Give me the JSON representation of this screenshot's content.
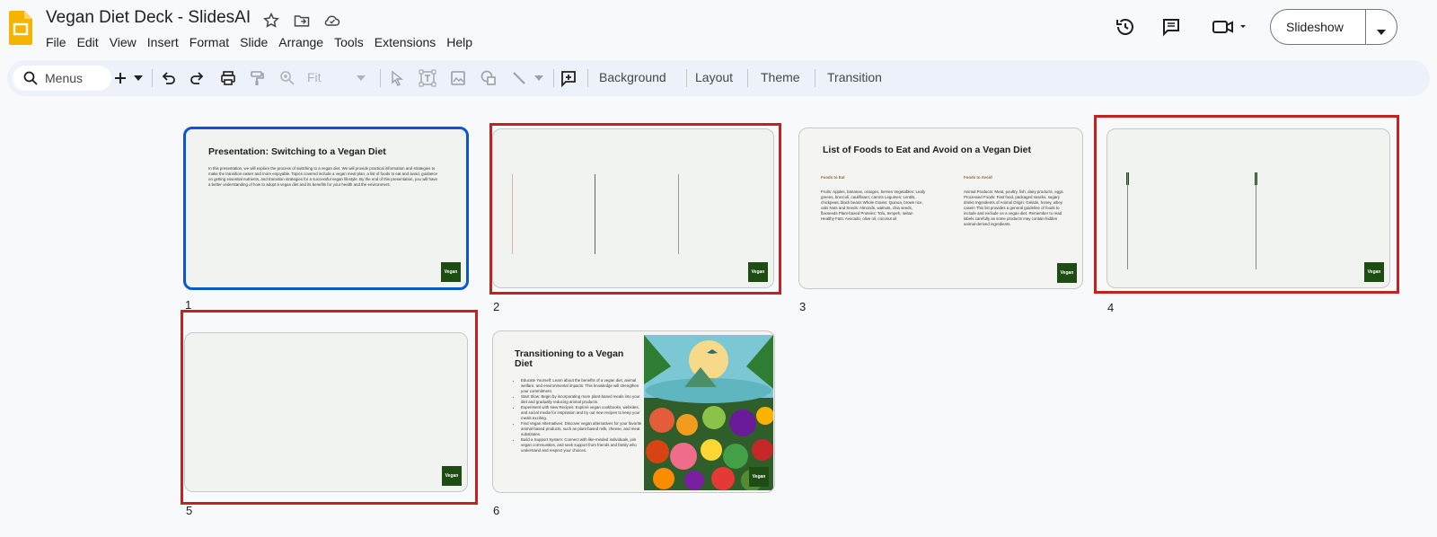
{
  "header": {
    "title": "Vegan Diet Deck - SlidesAI",
    "menu": [
      "File",
      "Edit",
      "View",
      "Insert",
      "Format",
      "Slide",
      "Arrange",
      "Tools",
      "Extensions",
      "Help"
    ],
    "slideshow_label": "Slideshow"
  },
  "toolbar": {
    "search_label": "Menus",
    "zoom_value": "Fit",
    "background_label": "Background",
    "layout_label": "Layout",
    "theme_label": "Theme",
    "transition_label": "Transition"
  },
  "slides": [
    {
      "number": "1",
      "title": "Presentation: Switching to a Vegan Diet",
      "body": "In this presentation, we will explore the process of switching to a vegan diet. We will provide practical information and strategies to make the transition easier and more enjoyable. Topics covered include a vegan meal plan, a list of foods to eat and avoid, guidance on getting essential nutrients, and transition strategies for a successful vegan lifestyle. By the end of this presentation, you will have a better understanding of how to adopt a vegan diet and its benefits for your health and the environment.",
      "badge": "Vegan"
    },
    {
      "number": "2",
      "badge": "Vegan"
    },
    {
      "number": "3",
      "title": "List of Foods to Eat and Avoid on a Vegan Diet",
      "col1_heading": "Foods to Eat",
      "col1_body": "Fruits: Apples, bananas, oranges, berries Vegetables: Leafy greens, broccoli, cauliflower, carrots Legumes: Lentils, chickpeas, black beans Whole Grains: Quinoa, brown rice, oats Nuts and Seeds: Almonds, walnuts, chia seeds, flaxseeds Plant-based Proteins: Tofu, tempeh, seitan Healthy Fats: Avocado, olive oil, coconut oil",
      "col2_heading": "Foods to Avoid",
      "col2_body": "Animal Products: Meat, poultry, fish, dairy products, eggs Processed Foods: Fast food, packaged snacks, sugary drinks Ingredients of Animal Origin: Gelatin, honey, whey casein This list provides a general guideline of foods to include and exclude on a vegan diet. Remember to read labels carefully as some products may contain hidden animal-derived ingredients.",
      "badge": "Vegan"
    },
    {
      "number": "4",
      "badge": "Vegan"
    },
    {
      "number": "5",
      "badge": "Vegan"
    },
    {
      "number": "6",
      "title": "Transitioning to a Vegan Diet",
      "bullets": [
        "Educate Yourself: Learn about the benefits of a vegan diet, animal welfare, and environmental impacts. This knowledge will strengthen your commitment.",
        "Start Slow: Begin by incorporating more plant-based meals into your diet and gradually reducing animal products.",
        "Experiment with New Recipes: Explore vegan cookbooks, websites, and social media for inspiration and try out new recipes to keep your meals exciting.",
        "Find Vegan Alternatives: Discover vegan alternatives for your favorite animal-based products, such as plant-based milk, cheese, and meat substitutes.",
        "Build a Support System: Connect with like-minded individuals, join vegan communities, and seek support from friends and family who understand and respect your choices."
      ],
      "badge": "Vegan"
    }
  ],
  "colors": {
    "selected": "#0b57d0",
    "highlight": "#c5221f",
    "badge": "#1e4d14"
  }
}
